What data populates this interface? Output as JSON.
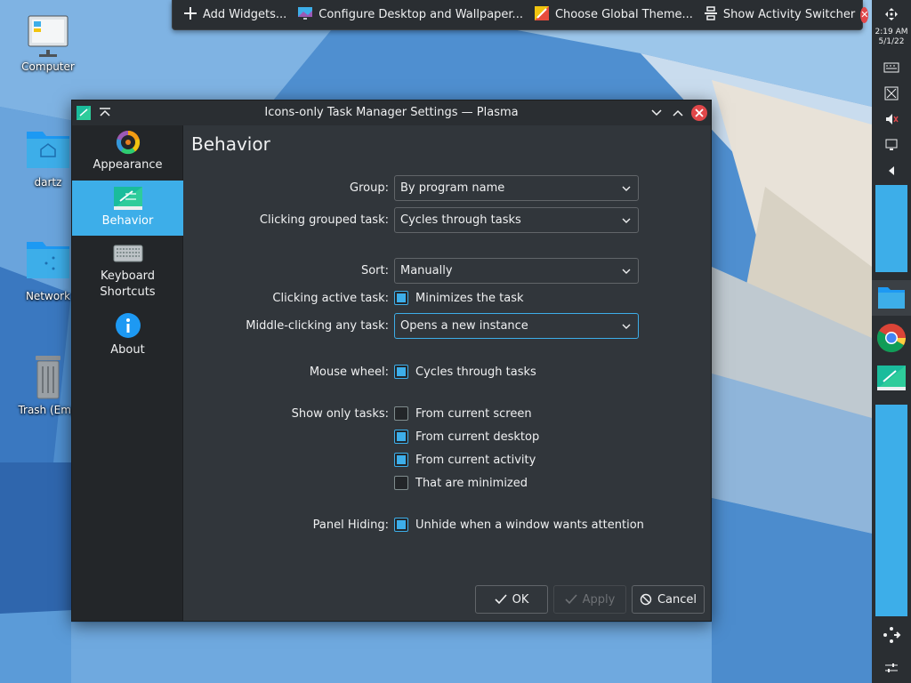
{
  "desktop": {
    "icons": [
      {
        "label": "Computer"
      },
      {
        "label": "dartz"
      },
      {
        "label": "Network"
      },
      {
        "label": "Trash (Emp"
      }
    ]
  },
  "toolbar": {
    "add_widgets": "Add Widgets...",
    "configure_desktop": "Configure Desktop and Wallpaper...",
    "choose_theme": "Choose Global Theme...",
    "activity_switcher": "Show Activity Switcher"
  },
  "panel": {
    "time": "2:19 AM",
    "date": "5/1/22"
  },
  "window": {
    "title": "Icons-only Task Manager Settings — Plasma"
  },
  "sidebar": {
    "items": [
      {
        "label": "Appearance"
      },
      {
        "label": "Behavior"
      },
      {
        "label": "Keyboard\nShortcuts",
        "line1": "Keyboard",
        "line2": "Shortcuts"
      },
      {
        "label": "About"
      }
    ]
  },
  "page": {
    "title": "Behavior",
    "group_label": "Group:",
    "group_value": "By program name",
    "clicking_grouped_label": "Clicking grouped task:",
    "clicking_grouped_value": "Cycles through tasks",
    "sort_label": "Sort:",
    "sort_value": "Manually",
    "clicking_active_label": "Clicking active task:",
    "clicking_active_option": "Minimizes the task",
    "middle_click_label": "Middle-clicking any task:",
    "middle_click_value": "Opens a new instance",
    "mouse_wheel_label": "Mouse wheel:",
    "mouse_wheel_option": "Cycles through tasks",
    "show_only_label": "Show only tasks:",
    "show_only_options": [
      {
        "label": "From current screen",
        "checked": false
      },
      {
        "label": "From current desktop",
        "checked": true
      },
      {
        "label": "From current activity",
        "checked": true
      },
      {
        "label": "That are minimized",
        "checked": false
      }
    ],
    "panel_hiding_label": "Panel Hiding:",
    "panel_hiding_option": "Unhide when a window wants attention"
  },
  "buttons": {
    "ok": "OK",
    "apply": "Apply",
    "cancel": "Cancel"
  },
  "colors": {
    "accent": "#3daee9",
    "window_bg": "#31363b",
    "sidebar_bg": "#232629",
    "close_red": "#e0474a"
  }
}
